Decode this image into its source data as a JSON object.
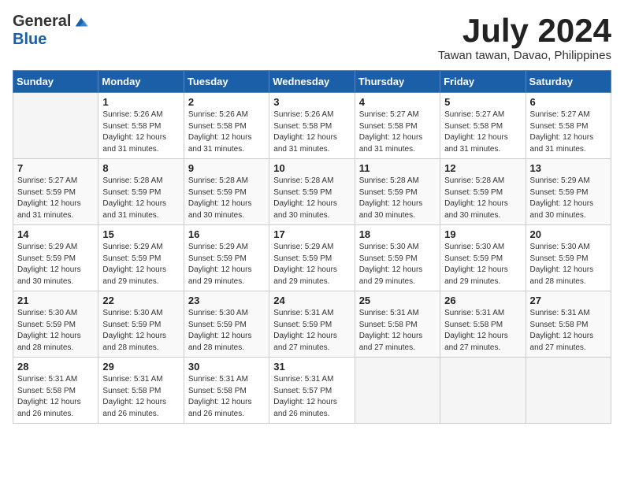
{
  "logo": {
    "general": "General",
    "blue": "Blue"
  },
  "title": "July 2024",
  "subtitle": "Tawan tawan, Davao, Philippines",
  "days_header": [
    "Sunday",
    "Monday",
    "Tuesday",
    "Wednesday",
    "Thursday",
    "Friday",
    "Saturday"
  ],
  "weeks": [
    [
      {
        "day": "",
        "info": ""
      },
      {
        "day": "1",
        "info": "Sunrise: 5:26 AM\nSunset: 5:58 PM\nDaylight: 12 hours\nand 31 minutes."
      },
      {
        "day": "2",
        "info": "Sunrise: 5:26 AM\nSunset: 5:58 PM\nDaylight: 12 hours\nand 31 minutes."
      },
      {
        "day": "3",
        "info": "Sunrise: 5:26 AM\nSunset: 5:58 PM\nDaylight: 12 hours\nand 31 minutes."
      },
      {
        "day": "4",
        "info": "Sunrise: 5:27 AM\nSunset: 5:58 PM\nDaylight: 12 hours\nand 31 minutes."
      },
      {
        "day": "5",
        "info": "Sunrise: 5:27 AM\nSunset: 5:58 PM\nDaylight: 12 hours\nand 31 minutes."
      },
      {
        "day": "6",
        "info": "Sunrise: 5:27 AM\nSunset: 5:58 PM\nDaylight: 12 hours\nand 31 minutes."
      }
    ],
    [
      {
        "day": "7",
        "info": "Sunrise: 5:27 AM\nSunset: 5:59 PM\nDaylight: 12 hours\nand 31 minutes."
      },
      {
        "day": "8",
        "info": "Sunrise: 5:28 AM\nSunset: 5:59 PM\nDaylight: 12 hours\nand 31 minutes."
      },
      {
        "day": "9",
        "info": "Sunrise: 5:28 AM\nSunset: 5:59 PM\nDaylight: 12 hours\nand 30 minutes."
      },
      {
        "day": "10",
        "info": "Sunrise: 5:28 AM\nSunset: 5:59 PM\nDaylight: 12 hours\nand 30 minutes."
      },
      {
        "day": "11",
        "info": "Sunrise: 5:28 AM\nSunset: 5:59 PM\nDaylight: 12 hours\nand 30 minutes."
      },
      {
        "day": "12",
        "info": "Sunrise: 5:28 AM\nSunset: 5:59 PM\nDaylight: 12 hours\nand 30 minutes."
      },
      {
        "day": "13",
        "info": "Sunrise: 5:29 AM\nSunset: 5:59 PM\nDaylight: 12 hours\nand 30 minutes."
      }
    ],
    [
      {
        "day": "14",
        "info": "Sunrise: 5:29 AM\nSunset: 5:59 PM\nDaylight: 12 hours\nand 30 minutes."
      },
      {
        "day": "15",
        "info": "Sunrise: 5:29 AM\nSunset: 5:59 PM\nDaylight: 12 hours\nand 29 minutes."
      },
      {
        "day": "16",
        "info": "Sunrise: 5:29 AM\nSunset: 5:59 PM\nDaylight: 12 hours\nand 29 minutes."
      },
      {
        "day": "17",
        "info": "Sunrise: 5:29 AM\nSunset: 5:59 PM\nDaylight: 12 hours\nand 29 minutes."
      },
      {
        "day": "18",
        "info": "Sunrise: 5:30 AM\nSunset: 5:59 PM\nDaylight: 12 hours\nand 29 minutes."
      },
      {
        "day": "19",
        "info": "Sunrise: 5:30 AM\nSunset: 5:59 PM\nDaylight: 12 hours\nand 29 minutes."
      },
      {
        "day": "20",
        "info": "Sunrise: 5:30 AM\nSunset: 5:59 PM\nDaylight: 12 hours\nand 28 minutes."
      }
    ],
    [
      {
        "day": "21",
        "info": "Sunrise: 5:30 AM\nSunset: 5:59 PM\nDaylight: 12 hours\nand 28 minutes."
      },
      {
        "day": "22",
        "info": "Sunrise: 5:30 AM\nSunset: 5:59 PM\nDaylight: 12 hours\nand 28 minutes."
      },
      {
        "day": "23",
        "info": "Sunrise: 5:30 AM\nSunset: 5:59 PM\nDaylight: 12 hours\nand 28 minutes."
      },
      {
        "day": "24",
        "info": "Sunrise: 5:31 AM\nSunset: 5:59 PM\nDaylight: 12 hours\nand 27 minutes."
      },
      {
        "day": "25",
        "info": "Sunrise: 5:31 AM\nSunset: 5:58 PM\nDaylight: 12 hours\nand 27 minutes."
      },
      {
        "day": "26",
        "info": "Sunrise: 5:31 AM\nSunset: 5:58 PM\nDaylight: 12 hours\nand 27 minutes."
      },
      {
        "day": "27",
        "info": "Sunrise: 5:31 AM\nSunset: 5:58 PM\nDaylight: 12 hours\nand 27 minutes."
      }
    ],
    [
      {
        "day": "28",
        "info": "Sunrise: 5:31 AM\nSunset: 5:58 PM\nDaylight: 12 hours\nand 26 minutes."
      },
      {
        "day": "29",
        "info": "Sunrise: 5:31 AM\nSunset: 5:58 PM\nDaylight: 12 hours\nand 26 minutes."
      },
      {
        "day": "30",
        "info": "Sunrise: 5:31 AM\nSunset: 5:58 PM\nDaylight: 12 hours\nand 26 minutes."
      },
      {
        "day": "31",
        "info": "Sunrise: 5:31 AM\nSunset: 5:57 PM\nDaylight: 12 hours\nand 26 minutes."
      },
      {
        "day": "",
        "info": ""
      },
      {
        "day": "",
        "info": ""
      },
      {
        "day": "",
        "info": ""
      }
    ]
  ]
}
